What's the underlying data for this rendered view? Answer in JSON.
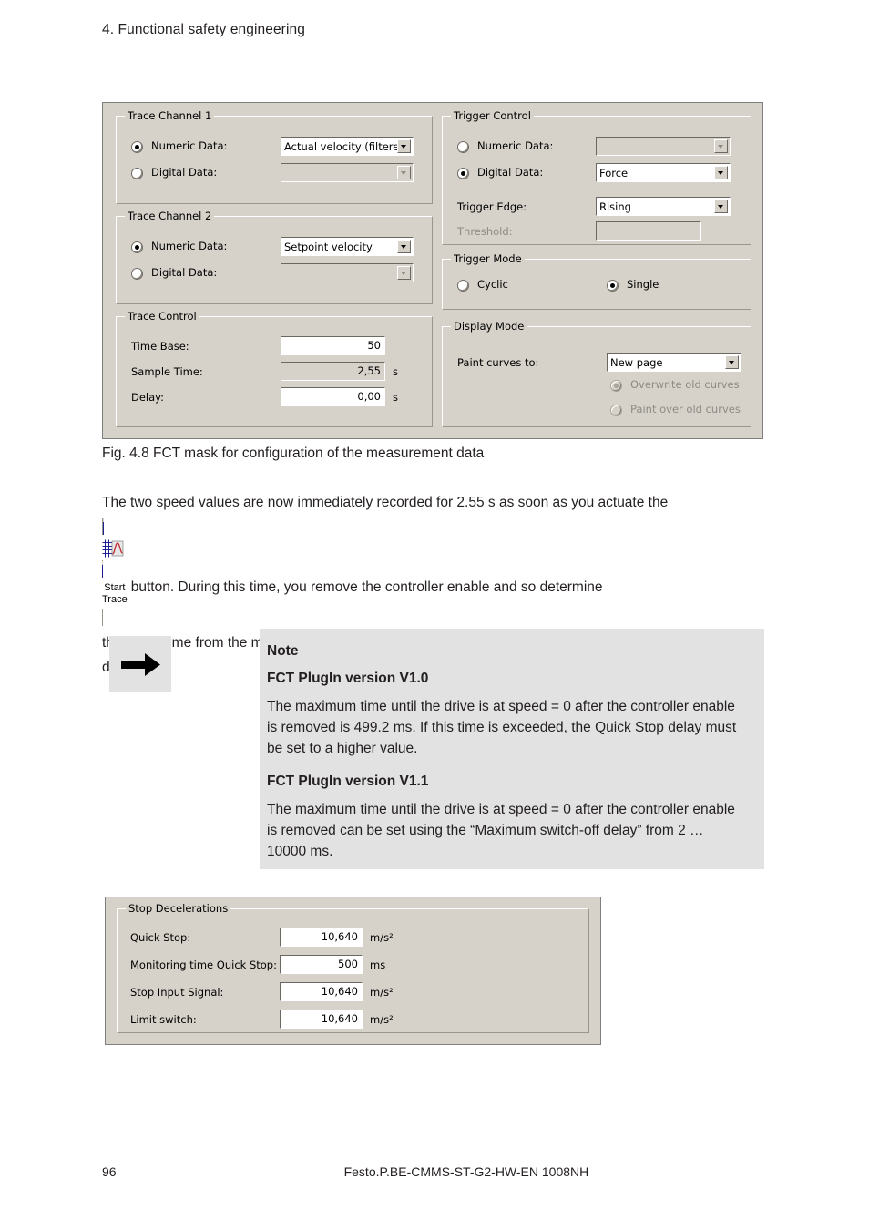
{
  "document": {
    "header": "4. Functional safety engineering",
    "figure_caption": "Fig. 4.8 FCT mask for configuration of the measurement data",
    "footer_page": "96",
    "footer_docid": "Festo.P.BE-CMMS-ST-G2-HW-EN 1008NH"
  },
  "body": {
    "line1": "The two speed values are now immediately recorded for 2.55 s as soon as you actuate the",
    "line2": "button. During this time, you remove the controller enable and so determine",
    "line3": "the brake time from the measurement curve. This is stored under the point “Measurement",
    "line4": "data”."
  },
  "trace_button": {
    "icon": "chart-grid-curve-icon",
    "label_line1": "Start",
    "label_line2": "Trace"
  },
  "note": {
    "icon": "arrow-right-icon",
    "title": "Note",
    "sub1": "FCT PlugIn version V1.0",
    "para1": "The maximum time until the drive is at speed = 0 after the controller enable is removed is 499.2 ms. If this time is exceeded, the Quick Stop delay must be set to a higher value.",
    "sub2": "FCT PlugIn version V1.1",
    "para2": "The maximum time until the drive is at speed = 0 after the controller enable is removed can be set using the “Maximum switch-off delay” from 2 … 10000 ms."
  },
  "fct_mask": {
    "trace_channel_1": {
      "title": "Trace Channel 1",
      "numeric_label": "Numeric Data:",
      "numeric_selected": true,
      "numeric_value": "Actual velocity (filtere",
      "digital_label": "Digital Data:",
      "digital_selected": false,
      "digital_value": ""
    },
    "trace_channel_2": {
      "title": "Trace Channel 2",
      "numeric_label": "Numeric Data:",
      "numeric_selected": true,
      "numeric_value": "Setpoint velocity",
      "digital_label": "Digital Data:",
      "digital_selected": false,
      "digital_value": ""
    },
    "trace_control": {
      "title": "Trace Control",
      "time_base_label": "Time Base:",
      "time_base_value": "50",
      "sample_time_label": "Sample Time:",
      "sample_time_value": "2,55",
      "sample_time_unit": "s",
      "delay_label": "Delay:",
      "delay_value": "0,00",
      "delay_unit": "s"
    },
    "trigger_control": {
      "title": "Trigger Control",
      "numeric_label": "Numeric Data:",
      "numeric_selected": false,
      "numeric_value": "",
      "digital_label": "Digital Data:",
      "digital_selected": true,
      "digital_value": "Force",
      "trigger_edge_label": "Trigger Edge:",
      "trigger_edge_value": "Rising",
      "threshold_label": "Threshold:",
      "threshold_value": ""
    },
    "trigger_mode": {
      "title": "Trigger Mode",
      "cyclic_label": "Cyclic",
      "cyclic_selected": false,
      "single_label": "Single",
      "single_selected": true
    },
    "display_mode": {
      "title": "Display Mode",
      "paint_curves_label": "Paint curves to:",
      "paint_curves_value": "New page",
      "overwrite_label": "Overwrite old curves",
      "overwrite_selected": true,
      "paint_over_label": "Paint over old curves",
      "paint_over_selected": false
    }
  },
  "stop_decelerations": {
    "title": "Stop Decelerations",
    "rows": [
      {
        "label": "Quick Stop:",
        "value": "10,640",
        "unit": "m/s²"
      },
      {
        "label": "Monitoring time Quick Stop:",
        "value": "500",
        "unit": "ms"
      },
      {
        "label": "Stop Input Signal:",
        "value": "10,640",
        "unit": "m/s²"
      },
      {
        "label": "Limit switch:",
        "value": "10,640",
        "unit": "m/s²"
      }
    ]
  },
  "colors": {
    "dialog_bg": "#d6d2ca",
    "note_bg": "#e2e2e2",
    "text": "#231f20",
    "icon_blue": "#1b1f8f",
    "icon_red": "#c0272d"
  }
}
